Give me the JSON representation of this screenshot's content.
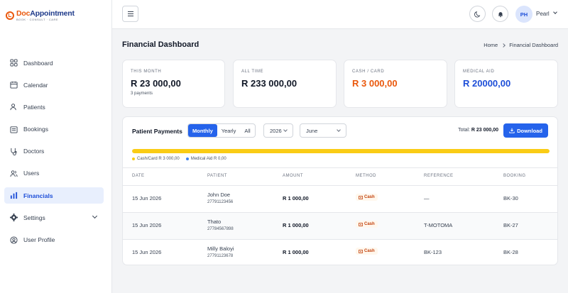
{
  "brand": {
    "name_prefix": "Doc",
    "name_rest": "Appointment",
    "tagline": "BOOK · CONSULT · CARE",
    "accent": "#ea580c"
  },
  "sidebar": {
    "items": [
      {
        "label": "Dashboard",
        "icon": "grid-icon"
      },
      {
        "label": "Calendar",
        "icon": "calendar-icon"
      },
      {
        "label": "Patients",
        "icon": "users-icon"
      },
      {
        "label": "Bookings",
        "icon": "clipboard-icon"
      },
      {
        "label": "Doctors",
        "icon": "stethoscope-icon"
      },
      {
        "label": "Users",
        "icon": "user-group-icon"
      },
      {
        "label": "Financials",
        "icon": "bar-chart-icon",
        "active": true
      },
      {
        "label": "Settings",
        "icon": "gear-icon"
      },
      {
        "label": "User Profile",
        "icon": "user-circle-icon"
      }
    ]
  },
  "topbar": {
    "user_initials": "PH",
    "user_name": "Pearl"
  },
  "page": {
    "title": "Financial Dashboard",
    "breadcrumb_home": "Home",
    "breadcrumb_current": "Financial Dashboard"
  },
  "stats": [
    {
      "label": "THIS MONTH",
      "value": "R 23 000,00",
      "sub": "3 payments",
      "color": "#111827"
    },
    {
      "label": "ALL TIME",
      "value": "R 233 000,00",
      "color": "#111827"
    },
    {
      "label": "CASH / CARD",
      "value": "R 3 000,00",
      "color": "#ea580c"
    },
    {
      "label": "MEDICAL AID",
      "value": "R 20000,00",
      "color": "#1d4ed8"
    }
  ],
  "payments": {
    "title": "Patient Payments",
    "periods": [
      "Monthly",
      "Yearly",
      "All"
    ],
    "selected_period": "Monthly",
    "year": "2026",
    "month": "June",
    "total_label": "Total:",
    "total_value": "R 23 000,00",
    "download_label": "Download",
    "progress": 1.0,
    "legend": {
      "cash": "Cash/Card R 3 000,00",
      "medical": "Medical Aid R 0,00"
    },
    "columns": [
      "DATE",
      "PATIENT",
      "AMOUNT",
      "METHOD",
      "REFERENCE",
      "BOOKING"
    ],
    "rows": [
      {
        "date": "15 Jun 2026",
        "name": "John Doe",
        "phone": "27791123456",
        "amount": "R 1 000,00",
        "method": "Cash",
        "reference": "—",
        "booking": "BK-30"
      },
      {
        "date": "15 Jun 2026",
        "name": "Thato",
        "phone": "27784567898",
        "amount": "R 1 000,00",
        "method": "Cash",
        "reference": "T-MOTOMA",
        "booking": "BK-27"
      },
      {
        "date": "15 Jun 2026",
        "name": "Milly Baloyi",
        "phone": "27791123678",
        "amount": "R 1 000,00",
        "method": "Cash",
        "reference": "BK-123",
        "booking": "BK-28"
      }
    ]
  },
  "colors": {
    "primary": "#2563eb",
    "progress": "#facc15",
    "medical_dot": "#3b82f6",
    "cash_dot": "#facc15"
  }
}
